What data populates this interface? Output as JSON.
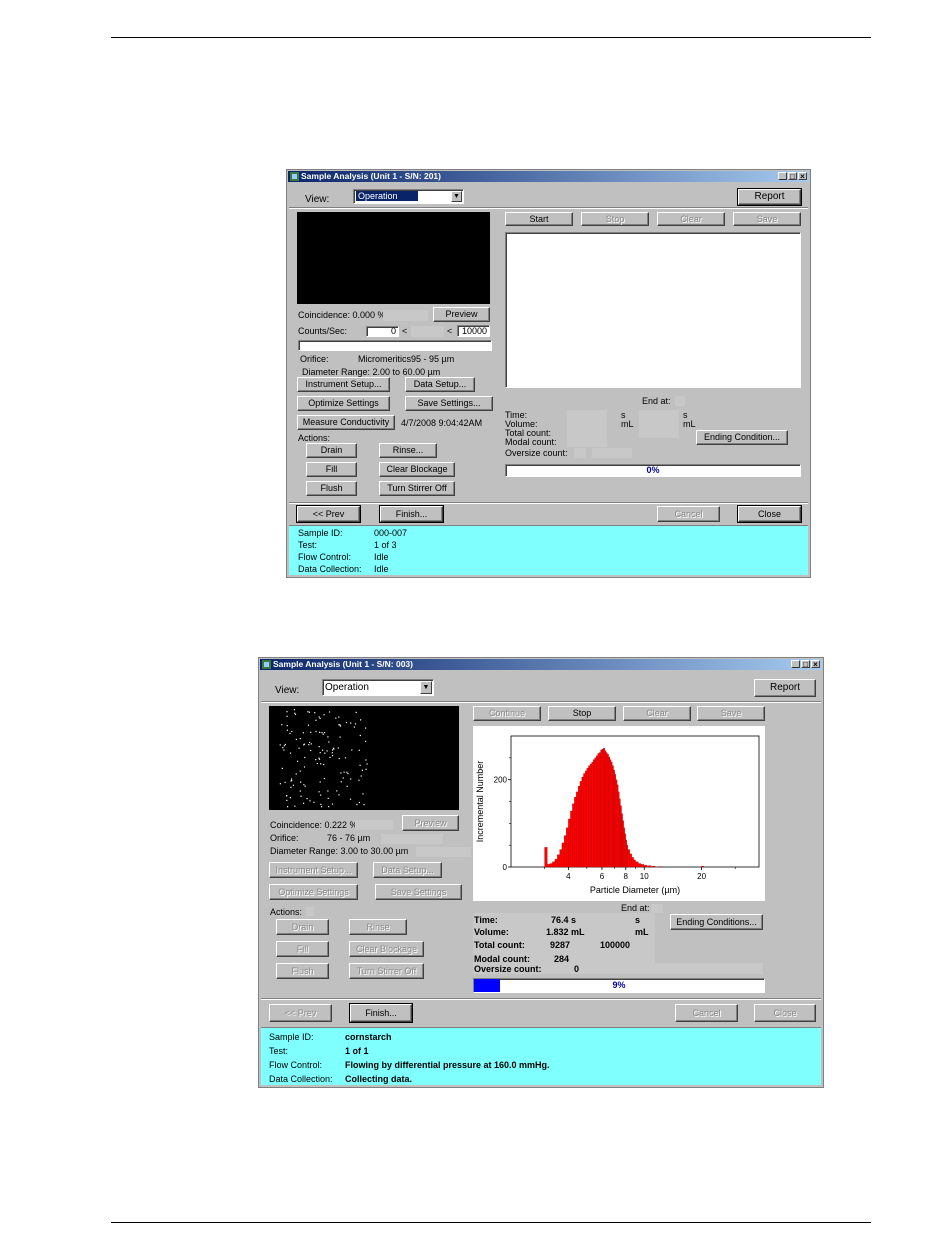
{
  "screen1": {
    "title": "Sample Analysis (Unit 1 - S/N: 201)",
    "view_label": "View:",
    "view_value": "Operation",
    "report_btn": "Report",
    "start_btn": "Start",
    "stop_btn": "Stop",
    "clear_btn": "Clear",
    "save_btn": "Save",
    "coincidence": "Coincidence: 0.000 %",
    "preview_btn": "Preview",
    "counts_label": "Counts/Sec:",
    "counts_value": "0",
    "lt1": "<",
    "lt2": "<",
    "counts_max": "10000",
    "orifice_label": "Orifice:",
    "orifice_value": "Micromeritics95 -   95 µm",
    "diameter_range": "Diameter Range: 2.00 to 60.00 µm",
    "instrument_setup_btn": "Instrument Setup...",
    "data_setup_btn": "Data Setup...",
    "optimize_btn": "Optimize Settings",
    "save_settings_btn": "Save Settings...",
    "measure_btn": "Measure Conductivity",
    "measure_time": "4/7/2008 9:04:42AM",
    "actions_label": "Actions:",
    "drain_btn": "Drain",
    "rinse_btn": "Rinse...",
    "fill_btn": "Fill",
    "clear_blockage_btn": "Clear Blockage",
    "flush_btn": "Flush",
    "stirrer_btn": "Turn Stirrer Off",
    "end_at": "End at:",
    "time_label": "Time:",
    "time_unit": "s",
    "time_unit2": "s",
    "volume_label": "Volume:",
    "volume_unit": "mL",
    "volume_unit2": "mL",
    "total_label": "Total count:",
    "modal_label": "Modal count:",
    "oversize_label": "Oversize count:",
    "ending_btn": "Ending Condition...",
    "progress_text": "0%",
    "progress": 0,
    "prev_btn": "<< Prev",
    "finish_btn": "Finish...",
    "cancel_btn": "Cancel",
    "close_btn": "Close",
    "status": [
      {
        "label": "Sample ID:",
        "value": "000-007"
      },
      {
        "label": "Test:",
        "value": "1 of 3"
      },
      {
        "label": "Flow Control:",
        "value": "Idle"
      },
      {
        "label": "Data Collection:",
        "value": "Idle"
      }
    ]
  },
  "screen2": {
    "title": "Sample Analysis (Unit 1 - S/N: 003)",
    "view_label": "View:",
    "view_value": "Operation",
    "report_btn": "Report",
    "continue_btn": "Continue",
    "stop_btn": "Stop",
    "clear_btn": "Clear",
    "save_btn": "Save",
    "coincidence": "Coincidence: 0.222 %",
    "preview_btn": "Preview",
    "orifice_label": "Orifice:",
    "orifice_value": "76 -   76 µm",
    "diameter_range": "Diameter Range: 3.00 to 30.00 µm",
    "instrument_setup_btn": "Instrument Setup...",
    "data_setup_btn": "Data Setup...",
    "optimize_btn": "Optimize Settings",
    "save_settings_btn": "Save Settings",
    "actions_label": "Actions:",
    "drain_btn": "Drain",
    "rinse_btn": "Rinse",
    "fill_btn": "Fill",
    "clear_blockage_btn": "Clear Blockage",
    "flush_btn": "Flush",
    "stirrer_btn": "Turn Stirrer Off",
    "end_at": "End at:",
    "time_label": "Time:",
    "time_value": "76.4 s",
    "time_unit2": "s",
    "volume_label": "Volume:",
    "volume_value": "1.832 mL",
    "volume_unit2": "mL",
    "total_label": "Total count:",
    "total_value": "9287",
    "total_end": "100000",
    "modal_label": "Modal count:",
    "modal_value": "284",
    "oversize_label": "Oversize count:",
    "oversize_value": "0",
    "ending_btn": "Ending Conditions...",
    "progress_text": "9%",
    "progress": 9,
    "prev_btn": "<< Prev",
    "finish_btn": "Finish...",
    "cancel_btn": "Cancel",
    "close_btn": "Close",
    "status": [
      {
        "label": "Sample ID:",
        "value": "cornstarch"
      },
      {
        "label": "Test:",
        "value": "1 of 1"
      },
      {
        "label": "Flow Control:",
        "value": "Flowing by differential pressure at 160.0 mmHg."
      },
      {
        "label": "Data Collection:",
        "value": "Collecting data."
      }
    ],
    "colors": {
      "bars": "#ff0000",
      "progress": "#0000ff",
      "status_bg": "#80ffff"
    }
  },
  "chart_data": {
    "type": "bar",
    "xlabel": "Particle Diameter (µm)",
    "ylabel": "Incremental Number",
    "x_scale": "log",
    "xlim": [
      2,
      40
    ],
    "ylim": [
      0,
      300
    ],
    "x_ticks": [
      4,
      6,
      8,
      10,
      20
    ],
    "x_tick_labels": [
      "4",
      "6",
      "8",
      "10",
      "20"
    ],
    "y_ticks": [
      0,
      200
    ],
    "y_tick_labels": [
      "0",
      "200"
    ],
    "bar_color": "#ff0000",
    "series": [
      {
        "x": [
          3.0,
          3.1,
          3.2,
          3.3,
          3.4,
          3.5,
          3.6,
          3.7,
          3.8,
          3.9,
          4.0,
          4.1,
          4.2,
          4.3,
          4.4,
          4.5,
          4.6,
          4.7,
          4.8,
          4.9,
          5.0,
          5.1,
          5.2,
          5.3,
          5.4,
          5.5,
          5.6,
          5.7,
          5.8,
          5.9,
          6.0,
          6.1,
          6.2,
          6.3,
          6.4,
          6.5,
          6.6,
          6.7,
          6.8,
          6.9,
          7.0,
          7.1,
          7.2,
          7.3,
          7.4,
          7.5,
          7.6,
          7.7,
          7.8,
          7.9,
          8.0,
          8.1,
          8.2,
          8.4,
          8.6,
          8.8,
          9.0,
          9.3,
          9.6,
          10.0,
          10.5,
          11.0,
          12.0,
          20.0
        ],
        "values": [
          45,
          6,
          8,
          12,
          18,
          28,
          40,
          55,
          72,
          90,
          110,
          128,
          145,
          160,
          172,
          185,
          196,
          206,
          214,
          220,
          226,
          232,
          236,
          240,
          246,
          250,
          255,
          260,
          262,
          268,
          270,
          272,
          266,
          262,
          258,
          252,
          246,
          240,
          232,
          222,
          212,
          200,
          188,
          172,
          156,
          140,
          122,
          106,
          90,
          76,
          62,
          50,
          40,
          30,
          22,
          16,
          12,
          8,
          6,
          4,
          3,
          2,
          1,
          2
        ]
      }
    ]
  }
}
